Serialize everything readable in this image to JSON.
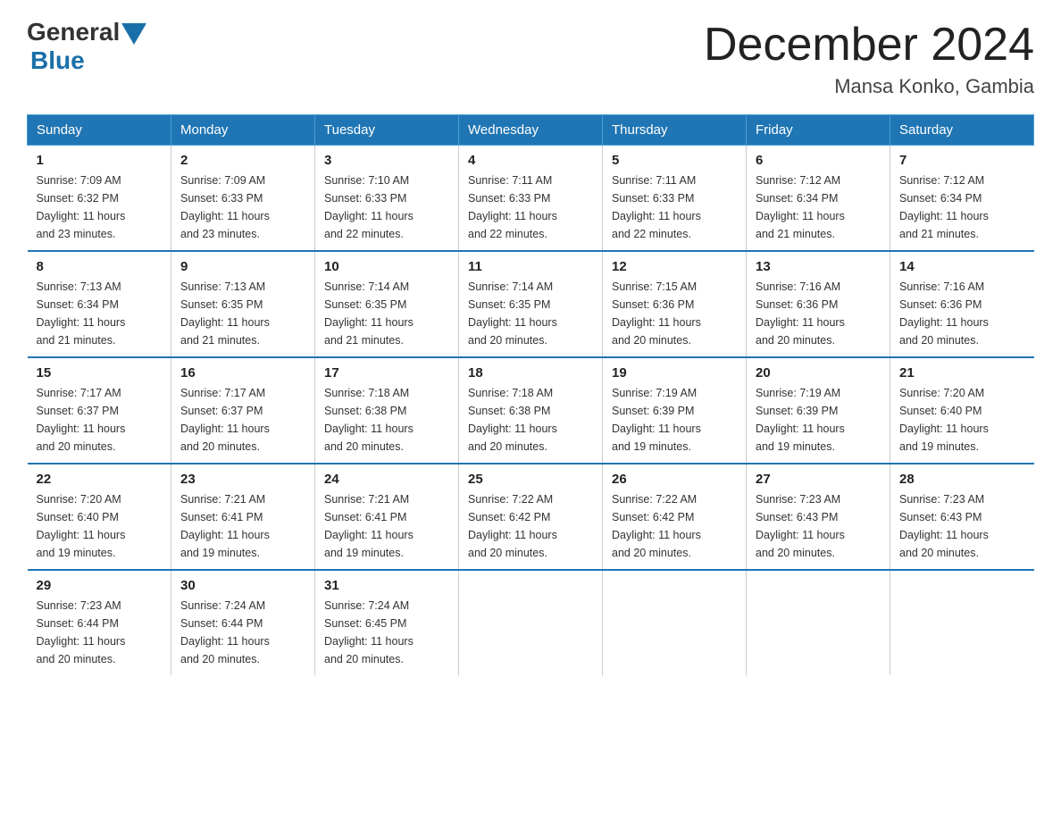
{
  "header": {
    "logo_general": "General",
    "logo_blue": "Blue",
    "month_title": "December 2024",
    "location": "Mansa Konko, Gambia"
  },
  "weekdays": [
    "Sunday",
    "Monday",
    "Tuesday",
    "Wednesday",
    "Thursday",
    "Friday",
    "Saturday"
  ],
  "weeks": [
    [
      {
        "day": "1",
        "sunrise": "7:09 AM",
        "sunset": "6:32 PM",
        "daylight": "11 hours and 23 minutes."
      },
      {
        "day": "2",
        "sunrise": "7:09 AM",
        "sunset": "6:33 PM",
        "daylight": "11 hours and 23 minutes."
      },
      {
        "day": "3",
        "sunrise": "7:10 AM",
        "sunset": "6:33 PM",
        "daylight": "11 hours and 22 minutes."
      },
      {
        "day": "4",
        "sunrise": "7:11 AM",
        "sunset": "6:33 PM",
        "daylight": "11 hours and 22 minutes."
      },
      {
        "day": "5",
        "sunrise": "7:11 AM",
        "sunset": "6:33 PM",
        "daylight": "11 hours and 22 minutes."
      },
      {
        "day": "6",
        "sunrise": "7:12 AM",
        "sunset": "6:34 PM",
        "daylight": "11 hours and 21 minutes."
      },
      {
        "day": "7",
        "sunrise": "7:12 AM",
        "sunset": "6:34 PM",
        "daylight": "11 hours and 21 minutes."
      }
    ],
    [
      {
        "day": "8",
        "sunrise": "7:13 AM",
        "sunset": "6:34 PM",
        "daylight": "11 hours and 21 minutes."
      },
      {
        "day": "9",
        "sunrise": "7:13 AM",
        "sunset": "6:35 PM",
        "daylight": "11 hours and 21 minutes."
      },
      {
        "day": "10",
        "sunrise": "7:14 AM",
        "sunset": "6:35 PM",
        "daylight": "11 hours and 21 minutes."
      },
      {
        "day": "11",
        "sunrise": "7:14 AM",
        "sunset": "6:35 PM",
        "daylight": "11 hours and 20 minutes."
      },
      {
        "day": "12",
        "sunrise": "7:15 AM",
        "sunset": "6:36 PM",
        "daylight": "11 hours and 20 minutes."
      },
      {
        "day": "13",
        "sunrise": "7:16 AM",
        "sunset": "6:36 PM",
        "daylight": "11 hours and 20 minutes."
      },
      {
        "day": "14",
        "sunrise": "7:16 AM",
        "sunset": "6:36 PM",
        "daylight": "11 hours and 20 minutes."
      }
    ],
    [
      {
        "day": "15",
        "sunrise": "7:17 AM",
        "sunset": "6:37 PM",
        "daylight": "11 hours and 20 minutes."
      },
      {
        "day": "16",
        "sunrise": "7:17 AM",
        "sunset": "6:37 PM",
        "daylight": "11 hours and 20 minutes."
      },
      {
        "day": "17",
        "sunrise": "7:18 AM",
        "sunset": "6:38 PM",
        "daylight": "11 hours and 20 minutes."
      },
      {
        "day": "18",
        "sunrise": "7:18 AM",
        "sunset": "6:38 PM",
        "daylight": "11 hours and 20 minutes."
      },
      {
        "day": "19",
        "sunrise": "7:19 AM",
        "sunset": "6:39 PM",
        "daylight": "11 hours and 19 minutes."
      },
      {
        "day": "20",
        "sunrise": "7:19 AM",
        "sunset": "6:39 PM",
        "daylight": "11 hours and 19 minutes."
      },
      {
        "day": "21",
        "sunrise": "7:20 AM",
        "sunset": "6:40 PM",
        "daylight": "11 hours and 19 minutes."
      }
    ],
    [
      {
        "day": "22",
        "sunrise": "7:20 AM",
        "sunset": "6:40 PM",
        "daylight": "11 hours and 19 minutes."
      },
      {
        "day": "23",
        "sunrise": "7:21 AM",
        "sunset": "6:41 PM",
        "daylight": "11 hours and 19 minutes."
      },
      {
        "day": "24",
        "sunrise": "7:21 AM",
        "sunset": "6:41 PM",
        "daylight": "11 hours and 19 minutes."
      },
      {
        "day": "25",
        "sunrise": "7:22 AM",
        "sunset": "6:42 PM",
        "daylight": "11 hours and 20 minutes."
      },
      {
        "day": "26",
        "sunrise": "7:22 AM",
        "sunset": "6:42 PM",
        "daylight": "11 hours and 20 minutes."
      },
      {
        "day": "27",
        "sunrise": "7:23 AM",
        "sunset": "6:43 PM",
        "daylight": "11 hours and 20 minutes."
      },
      {
        "day": "28",
        "sunrise": "7:23 AM",
        "sunset": "6:43 PM",
        "daylight": "11 hours and 20 minutes."
      }
    ],
    [
      {
        "day": "29",
        "sunrise": "7:23 AM",
        "sunset": "6:44 PM",
        "daylight": "11 hours and 20 minutes."
      },
      {
        "day": "30",
        "sunrise": "7:24 AM",
        "sunset": "6:44 PM",
        "daylight": "11 hours and 20 minutes."
      },
      {
        "day": "31",
        "sunrise": "7:24 AM",
        "sunset": "6:45 PM",
        "daylight": "11 hours and 20 minutes."
      },
      null,
      null,
      null,
      null
    ]
  ],
  "labels": {
    "sunrise": "Sunrise:",
    "sunset": "Sunset:",
    "daylight": "Daylight:"
  }
}
